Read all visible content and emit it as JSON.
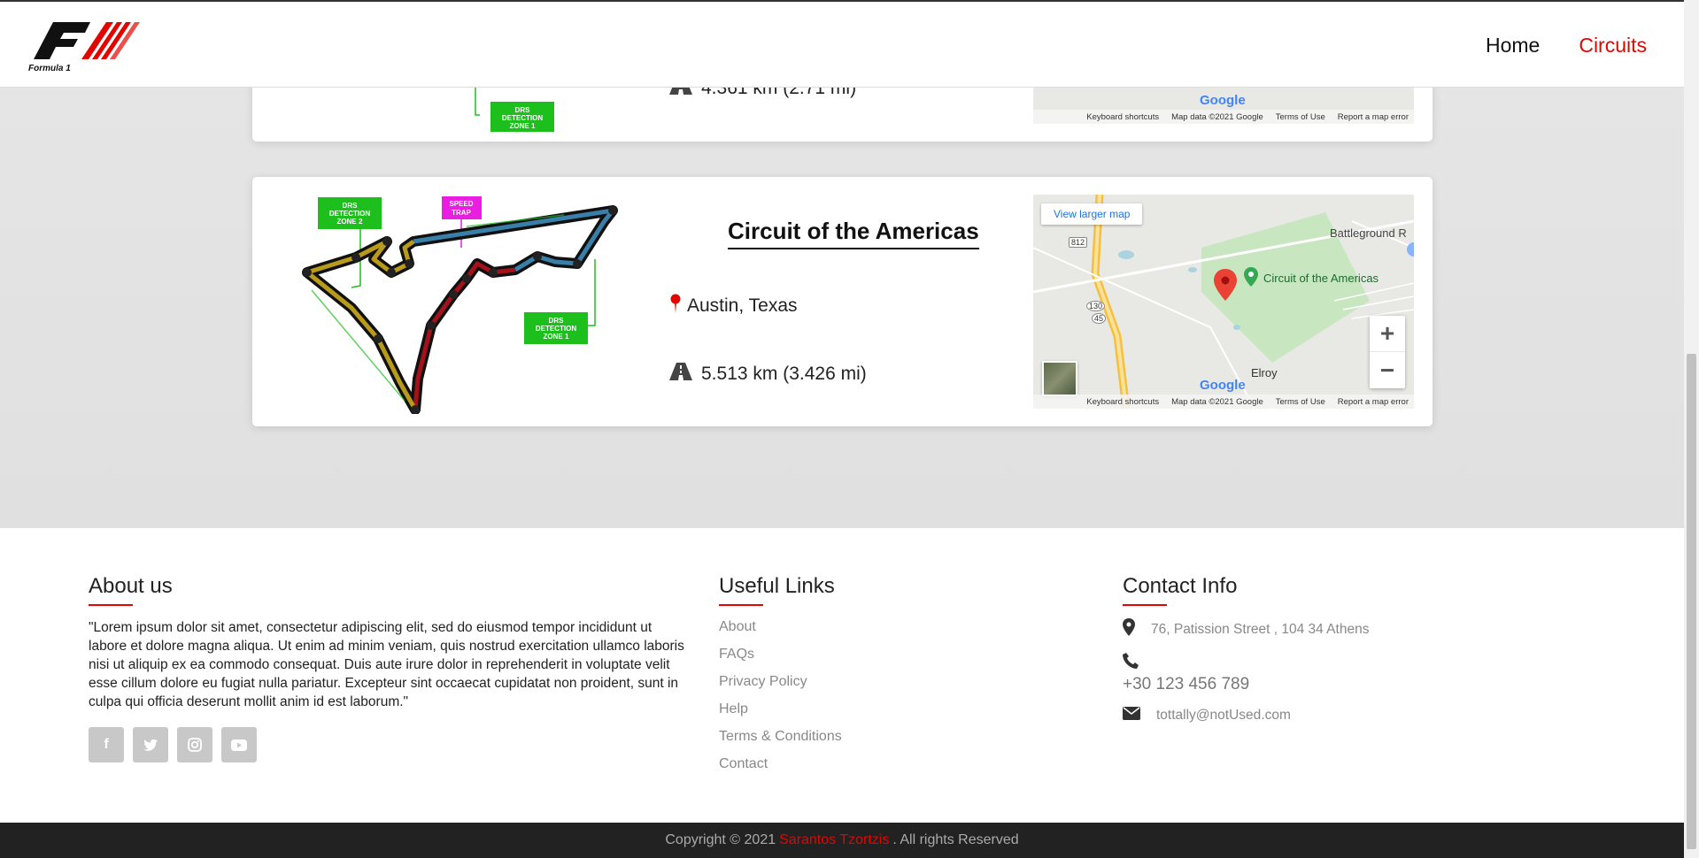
{
  "nav": {
    "logo_text": "Formula 1",
    "links": [
      {
        "label": "Home",
        "active": false
      },
      {
        "label": "Circuits",
        "active": true
      }
    ]
  },
  "circuits": [
    {
      "length": "4.361 km (2.71 mi)",
      "map": {
        "shortcuts": "Keyboard shortcuts",
        "data": "Map data ©2021 Google",
        "terms": "Terms of Use",
        "report": "Report a map error",
        "google": "Google"
      }
    },
    {
      "name": "Circuit of the Americas",
      "location": "Austin, Texas",
      "length": "5.513 km (3.426 mi)",
      "track_labels": {
        "drs_zone_2": "DRS DETECTION ZONE 2",
        "speed_trap": "SPEED TRAP",
        "drs_zone_1": "DRS DETECTION ZONE 1"
      },
      "map": {
        "view_larger": "View larger map",
        "place": "Circuit of the Americas",
        "battleground": "Battleground R",
        "elroy": "Elroy",
        "road_812": "812",
        "road_130": "130",
        "road_45": "45",
        "google": "Google",
        "shortcuts": "Keyboard shortcuts",
        "data": "Map data ©2021 Google",
        "terms": "Terms of Use",
        "report": "Report a map error",
        "zoom_in": "+",
        "zoom_out": "−"
      }
    }
  ],
  "footer": {
    "about": {
      "title": "About us",
      "text": "\"Lorem ipsum dolor sit amet, consectetur adipiscing elit, sed do eiusmod tempor incididunt ut labore et dolore magna aliqua. Ut enim ad minim veniam, quis nostrud exercitation ullamco laboris nisi ut aliquip ex ea commodo consequat. Duis aute irure dolor in reprehenderit in voluptate velit esse cillum dolore eu fugiat nulla pariatur. Excepteur sint occaecat cupidatat non proident, sunt in culpa qui officia deserunt mollit anim id est laborum.\"",
      "socials": [
        "facebook-icon",
        "twitter-icon",
        "instagram-icon",
        "youtube-icon"
      ]
    },
    "links": {
      "title": "Useful Links",
      "items": [
        "About",
        "FAQs",
        "Privacy Policy",
        "Help",
        "Terms & Conditions",
        "Contact"
      ]
    },
    "contact": {
      "title": "Contact Info",
      "address": "76, Patission Street , 104 34 Athens",
      "phone": "+30 123 456 789",
      "email": "tottally@notUsed.com"
    }
  },
  "copyright": {
    "prefix": "Copyright © 2021",
    "author": "Sarantos Tzortzis",
    "suffix": ". All rights Reserved"
  },
  "colors": {
    "accent": "#e10600",
    "drs_green": "#1dbf1d",
    "speed_trap": "#e91ee0"
  }
}
